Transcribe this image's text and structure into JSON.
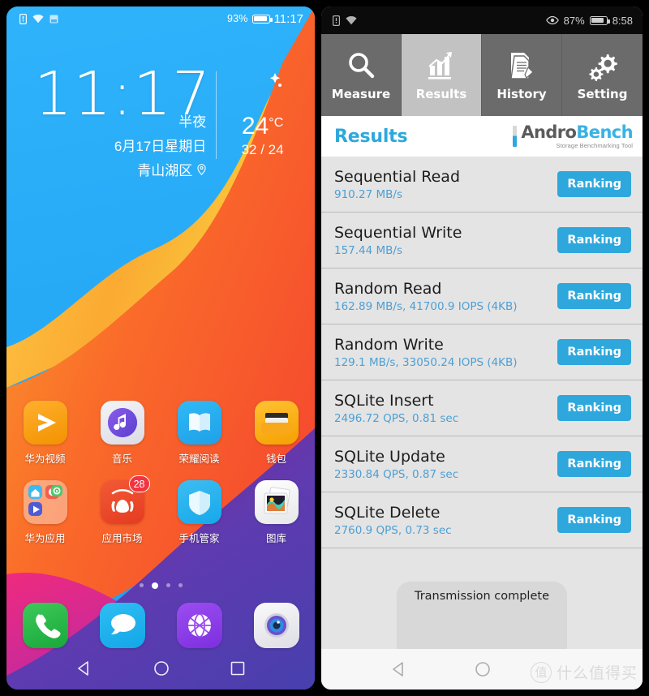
{
  "left_phone": {
    "status_bar": {
      "icons": [
        "sim-card-icon",
        "wifi-icon",
        "sd-card-icon"
      ],
      "battery_percent": "93%",
      "time": "11:17"
    },
    "clock_widget": {
      "time": "11:17",
      "period": "半夜",
      "date": "6月17日星期日",
      "location": "青山湖区",
      "weather": {
        "icon": "moon-stars-icon",
        "temp": "24",
        "unit": "°C",
        "high_low": "32 / 24"
      }
    },
    "app_rows": [
      [
        {
          "label": "华为视频",
          "icon": "huawei-video-icon"
        },
        {
          "label": "音乐",
          "icon": "music-icon"
        },
        {
          "label": "荣耀阅读",
          "icon": "honor-reading-icon"
        },
        {
          "label": "钱包",
          "icon": "wallet-icon"
        }
      ],
      [
        {
          "label": "华为应用",
          "icon": "huawei-apps-folder-icon"
        },
        {
          "label": "应用市场",
          "icon": "app-market-icon",
          "badge": "28"
        },
        {
          "label": "手机管家",
          "icon": "phone-manager-icon"
        },
        {
          "label": "图库",
          "icon": "gallery-icon"
        }
      ]
    ],
    "page_indicator": {
      "count": 4,
      "active": 1
    },
    "dock": [
      {
        "label": "",
        "icon": "phone-icon"
      },
      {
        "label": "",
        "icon": "messages-icon"
      },
      {
        "label": "",
        "icon": "browser-icon"
      },
      {
        "label": "",
        "icon": "camera-icon"
      }
    ],
    "nav_bar": [
      "back-icon",
      "home-icon",
      "recents-icon"
    ]
  },
  "right_phone": {
    "status_bar": {
      "icons": [
        "sim-card-icon",
        "wifi-icon"
      ],
      "eye_comfort_icon": "eye-icon",
      "battery_percent": "87%",
      "time": "8:58"
    },
    "tabs": [
      {
        "label": "Measure",
        "icon": "magnifier-icon",
        "active": false
      },
      {
        "label": "Results",
        "icon": "bar-chart-icon",
        "active": true
      },
      {
        "label": "History",
        "icon": "document-pencil-icon",
        "active": false
      },
      {
        "label": "Setting",
        "icon": "gears-icon",
        "active": false
      }
    ],
    "header": {
      "title": "Results",
      "logo_main_a": "Andro",
      "logo_main_b": "Bench",
      "logo_sub": "Storage Benchmarking Tool"
    },
    "results": [
      {
        "name": "Sequential Read",
        "value": "910.27 MB/s",
        "button": "Ranking"
      },
      {
        "name": "Sequential Write",
        "value": "157.44 MB/s",
        "button": "Ranking"
      },
      {
        "name": "Random Read",
        "value": "162.89 MB/s, 41700.9 IOPS (4KB)",
        "button": "Ranking"
      },
      {
        "name": "Random Write",
        "value": "129.1 MB/s, 33050.24 IOPS (4KB)",
        "button": "Ranking"
      },
      {
        "name": "SQLite Insert",
        "value": "2496.72 QPS, 0.81 sec",
        "button": "Ranking"
      },
      {
        "name": "SQLite Update",
        "value": "2330.84 QPS, 0.87 sec",
        "button": "Ranking"
      },
      {
        "name": "SQLite Delete",
        "value": "2760.9 QPS, 0.73 sec",
        "button": "Ranking"
      }
    ],
    "toast": "Transmission complete",
    "nav_bar": [
      "back-icon",
      "home-icon"
    ]
  },
  "watermark": {
    "mark": "值",
    "text": "什么值得买"
  },
  "colors": {
    "accent_blue": "#2ea8dc",
    "value_blue": "#4d9fd4",
    "tab_bg": "#6b6b6b",
    "tab_active_bg": "#c2c2c2",
    "list_bg": "#e4e4e4",
    "logo_gray": "#5b5b5b"
  }
}
